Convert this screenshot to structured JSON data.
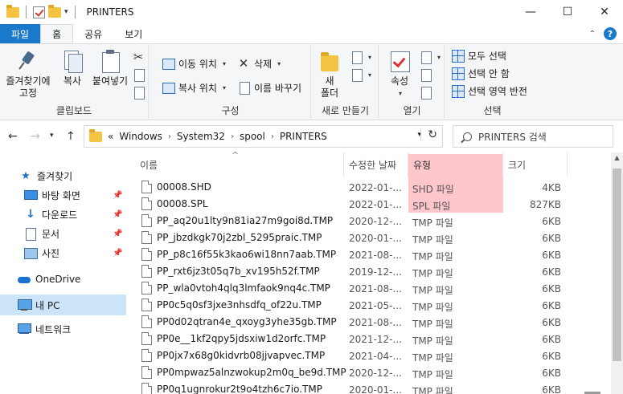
{
  "window": {
    "title": "PRINTERS",
    "minimize": "—",
    "maximize": "☐",
    "close": "✕"
  },
  "tabs": {
    "file": "파일",
    "home": "홈",
    "share": "공유",
    "view": "보기"
  },
  "ribbon": {
    "clipboard": {
      "label": "클립보드",
      "pin": "즐겨찾기에\n고정",
      "copy": "복사",
      "paste": "붙여넣기"
    },
    "organize": {
      "label": "구성",
      "move_to": "이동 위치",
      "copy_to": "복사 위치",
      "delete": "삭제",
      "rename": "이름 바꾸기"
    },
    "new": {
      "label": "새로 만들기",
      "new_folder": "새\n폴더"
    },
    "open": {
      "label": "열기",
      "properties": "속성"
    },
    "select": {
      "label": "선택",
      "select_all": "모두 선택",
      "select_none": "선택 안 함",
      "invert": "선택 영역 반전"
    }
  },
  "address": {
    "overflow": "«",
    "crumbs": [
      "Windows",
      "System32",
      "spool",
      "PRINTERS"
    ],
    "search_placeholder": "PRINTERS 검색"
  },
  "nav": {
    "quick_access": "즐겨찾기",
    "desktop": "바탕 화면",
    "downloads": "다운로드",
    "documents": "문서",
    "pictures": "사진",
    "onedrive": "OneDrive",
    "this_pc": "내 PC",
    "network": "네트워크"
  },
  "columns": {
    "name": "이름",
    "date": "수정한 날짜",
    "type": "유형",
    "size": "크기"
  },
  "files": [
    {
      "name": "00008.SHD",
      "date": "2022-01-...",
      "type": "SHD 파일",
      "size": "4KB"
    },
    {
      "name": "00008.SPL",
      "date": "2022-01-...",
      "type": "SPL 파일",
      "size": "827KB"
    },
    {
      "name": "PP_aq20u1lty9n81ia27m9goi8d.TMP",
      "date": "2020-12-...",
      "type": "TMP 파일",
      "size": "6KB"
    },
    {
      "name": "PP_jbzdkgk70j2zbl_5295praic.TMP",
      "date": "2020-01-...",
      "type": "TMP 파일",
      "size": "6KB"
    },
    {
      "name": "PP_p8c16f55k3kao6wi18nn7aab.TMP",
      "date": "2021-08-...",
      "type": "TMP 파일",
      "size": "6KB"
    },
    {
      "name": "PP_rxt6jz3t05q7b_xv195h52f.TMP",
      "date": "2019-12-...",
      "type": "TMP 파일",
      "size": "6KB"
    },
    {
      "name": "PP_wla0vtoh4qlq3lmfaok9nq4c.TMP",
      "date": "2021-08-...",
      "type": "TMP 파일",
      "size": "6KB"
    },
    {
      "name": "PP0c5q0sf3jxe3nhsdfq_of22u.TMP",
      "date": "2021-05-...",
      "type": "TMP 파일",
      "size": "6KB"
    },
    {
      "name": "PP0d02qtran4e_qxoyg3yhe35gb.TMP",
      "date": "2021-08-...",
      "type": "TMP 파일",
      "size": "6KB"
    },
    {
      "name": "PP0e__1kf2qpy5jdsxiw1d2orfc.TMP",
      "date": "2021-12-...",
      "type": "TMP 파일",
      "size": "6KB"
    },
    {
      "name": "PP0jx7x68g0kidvrb08jjvapvec.TMP",
      "date": "2021-04-...",
      "type": "TMP 파일",
      "size": "6KB"
    },
    {
      "name": "PP0mpwaz5alnzwokup2m0q_be9d.TMP",
      "date": "2020-12-...",
      "type": "TMP 파일",
      "size": "6KB"
    },
    {
      "name": "PP0q1ugnrokur2t9o4tzh6c7io.TMP",
      "date": "2020-01-...",
      "type": "TMP 파일",
      "size": "6KB"
    }
  ],
  "colors": {
    "accent": "#1979ca",
    "highlight": "#ffc4c8",
    "selected_nav": "#cce4f7"
  }
}
